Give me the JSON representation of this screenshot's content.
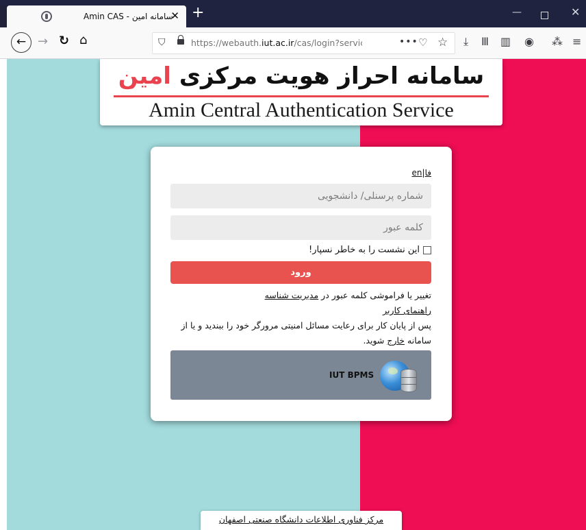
{
  "browser": {
    "tab_title": "Amin CAS - سامانه امین",
    "tab_close": "✕",
    "new_tab": "+",
    "url_host": "https://webauth.",
    "url_domain": "iut.ac.ir",
    "url_path": "/cas/login?service=",
    "url_fade": "h",
    "window_min": "—",
    "window_close": "✕"
  },
  "header": {
    "title_fa_main": "سامانه احراز هویت مرکزی",
    "title_fa_accent": "امین",
    "title_en": "Amin Central Authentication Service"
  },
  "login": {
    "lang_fa": "فا",
    "lang_sep": "|",
    "lang_en": "en",
    "username_placeholder": "شماره پرسنلی/ دانشجویی",
    "password_placeholder": "کلمه عبور",
    "remember_label": "این نشست را به خاطر نسپار!",
    "submit_label": "ورود",
    "change_password_text": "تغییر یا فراموشی کلمه عبور در",
    "identity_mgmt_link": "مدیریت شناسه",
    "user_guide_link": "راهنمای کاربر",
    "security_note": "پس از پایان کار برای رعایت مسائل امنیتی مرورگر خود را ببندید و یا از",
    "logout_prefix": "سامانه",
    "logout_link": "خارج",
    "logout_suffix": "شوید.",
    "bpms_label": "IUT BPMS"
  },
  "footer": {
    "link_text": "مرکز فناوری اطلاعات دانشگاه صنعتی اصفهان"
  },
  "colors": {
    "background_left": "#a3dbdd",
    "background_right": "#ef0d54",
    "accent_red": "#e8434f",
    "button_red": "#e8534f",
    "bpms_panel": "#7c8796",
    "titlebar": "#202340"
  },
  "icons": [
    "tab-favicon-icon",
    "back-icon",
    "forward-icon",
    "reload-icon",
    "home-icon",
    "tracking-shield-icon",
    "lock-icon",
    "page-actions-icon",
    "pocket-icon",
    "bookmark-star-icon",
    "download-icon",
    "library-icon",
    "sidebar-icon",
    "account-icon",
    "extension-icon",
    "menu-icon",
    "globe-database-icon"
  ]
}
